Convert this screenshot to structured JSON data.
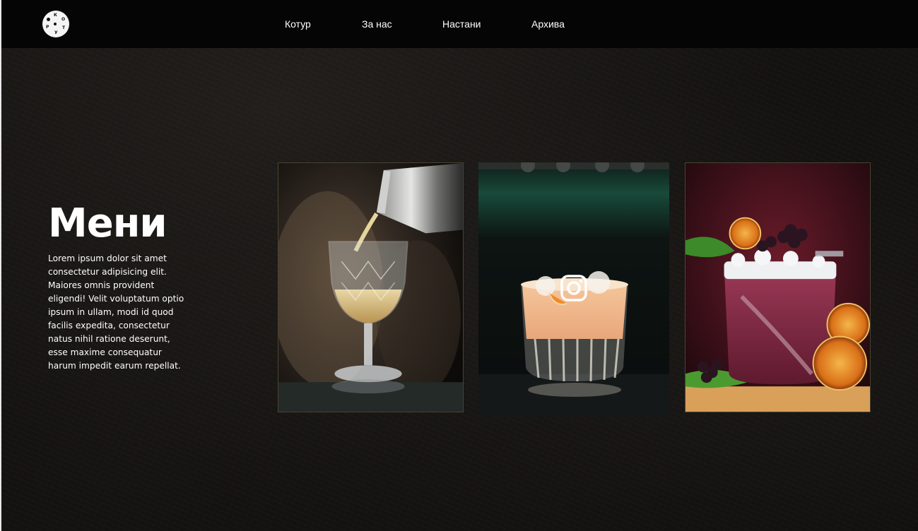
{
  "nav": {
    "logo_letters": [
      "К",
      "О",
      "Т",
      "У",
      "Р"
    ],
    "links": [
      {
        "label": "Котур"
      },
      {
        "label": "За нас"
      },
      {
        "label": "Настани"
      },
      {
        "label": "Архива"
      }
    ]
  },
  "hero": {
    "title": "Мени",
    "description": "Lorem ipsum dolor sit amet consectetur adipisicing elit. Maiores omnis provident eligendi! Velit voluptatum optio ipsum in ullam, modi id quod facilis expedita, consectetur natus nihil ratione deserunt, esse maxime consequatur harum impedit earum repellat."
  },
  "gallery": {
    "cards": [
      {
        "subject": "poured-wine-glass-cocktail"
      },
      {
        "subject": "peach-cocktail-rocks-glass",
        "overlay_icon": "instagram-icon"
      },
      {
        "subject": "berry-cocktail-with-orange-slices"
      }
    ]
  },
  "colors": {
    "nav_bg": "#050505",
    "page_bg": "#0e0d0c",
    "text": "#ffffff",
    "card_border": "#4a4230"
  }
}
